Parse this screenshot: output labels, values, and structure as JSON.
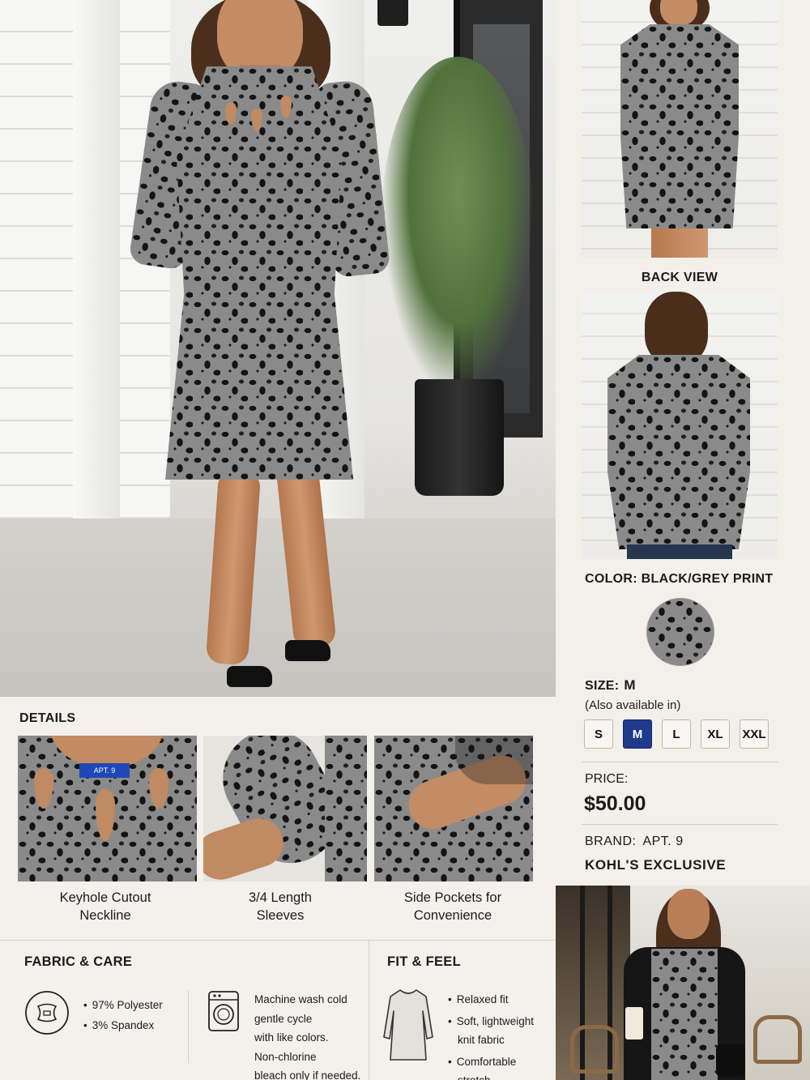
{
  "gallery": {
    "back_view_label": "BACK VIEW"
  },
  "product": {
    "color_label": "COLOR:",
    "color_value": "BLACK/GREY PRINT",
    "size_label": "SIZE:",
    "size_value": "M",
    "size_note": "(Also available in)",
    "sizes": [
      "S",
      "M",
      "L",
      "XL",
      "XXL"
    ],
    "selected_size": "M",
    "price_label": "PRICE:",
    "price_value": "$50.00",
    "brand_label": "BRAND:",
    "brand_value": "APT. 9",
    "exclusive": "KOHL'S  EXCLUSIVE",
    "accent_color": "#1f3a8a"
  },
  "details": {
    "title": "DETAILS",
    "items": [
      {
        "caption_l1": "Keyhole Cutout",
        "caption_l2": "Neckline",
        "tag_text": "APT. 9"
      },
      {
        "caption_l1": "3/4 Length",
        "caption_l2": "Sleeves"
      },
      {
        "caption_l1": "Side Pockets for",
        "caption_l2": "Convenience"
      }
    ]
  },
  "fabric_care": {
    "title": "FABRIC & CARE",
    "composition": [
      "97% Polyester",
      "3% Spandex"
    ],
    "care_lines": [
      "Machine wash cold",
      "gentle cycle",
      "with like colors.",
      "Non-chlorine",
      "bleach only if needed."
    ],
    "icons": [
      "fabric-icon",
      "washing-machine-icon"
    ]
  },
  "fit_feel": {
    "title": "FIT & FEEL",
    "bullets": [
      [
        "Relaxed fit"
      ],
      [
        "Soft, lightweight",
        "knit fabric"
      ],
      [
        "Comfortable",
        "stretch"
      ]
    ],
    "icon": "dress-outline-icon"
  }
}
